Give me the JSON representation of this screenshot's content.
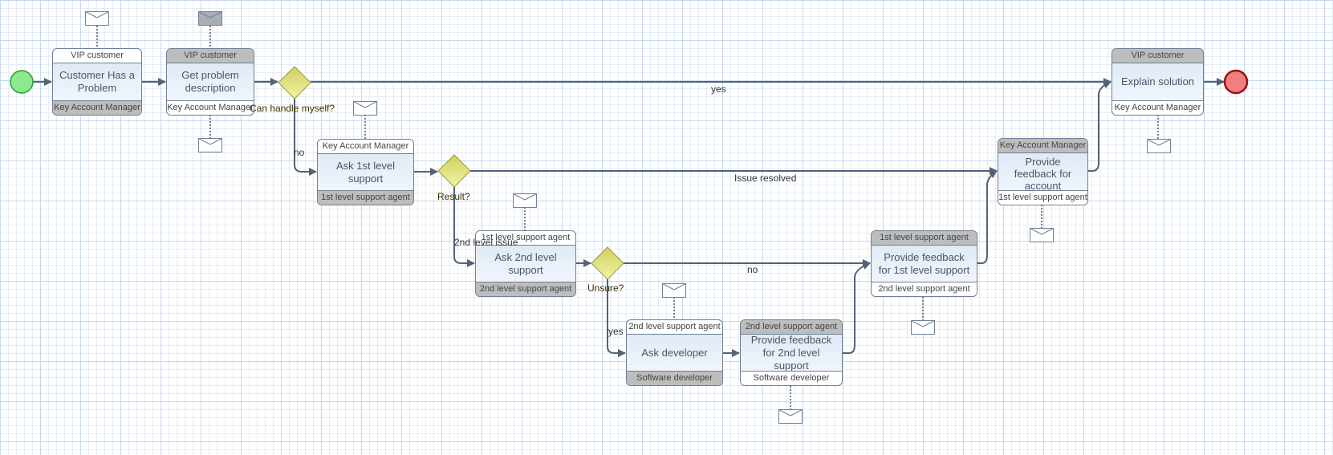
{
  "tasks": [
    {
      "name": "Customer Has a Problem",
      "top": "VIP customer",
      "bottom": "Key Account Manager"
    },
    {
      "name": "Get problem description",
      "top": "VIP customer",
      "bottom": "Key Account Manager"
    },
    {
      "name": "Ask 1st level support",
      "top": "Key Account Manager",
      "bottom": "1st level support agent"
    },
    {
      "name": "Ask 2nd level support",
      "top": "1st level support agent",
      "bottom": "2nd level support agent"
    },
    {
      "name": "Ask developer",
      "top": "2nd level support agent",
      "bottom": "Software developer"
    },
    {
      "name": "Provide feedback for 2nd level support",
      "top": "2nd level support agent",
      "bottom": "Software developer"
    },
    {
      "name": "Provide feedback for 1st level support",
      "top": "1st level support agent",
      "bottom": "2nd level support agent"
    },
    {
      "name": "Provide feedback for account manager",
      "top": "Key Account Manager",
      "bottom": "1st level support agent"
    },
    {
      "name": "Explain solution",
      "top": "VIP customer",
      "bottom": "Key Account Manager"
    }
  ],
  "gateways": [
    "Can handle myself?",
    "Result?",
    "Unsure?"
  ],
  "edge_labels": {
    "yes_top": "yes",
    "no_1": "no",
    "issue_resolved": "Issue resolved",
    "second_level_issue": "2nd level issue",
    "no_2": "no",
    "yes_dev": "yes"
  },
  "colors": {
    "start": "#8ee88e",
    "end": "#f08080",
    "gateway": "#e0e080",
    "participant_shaded": "#bdbdbd",
    "edge": "#536274"
  }
}
